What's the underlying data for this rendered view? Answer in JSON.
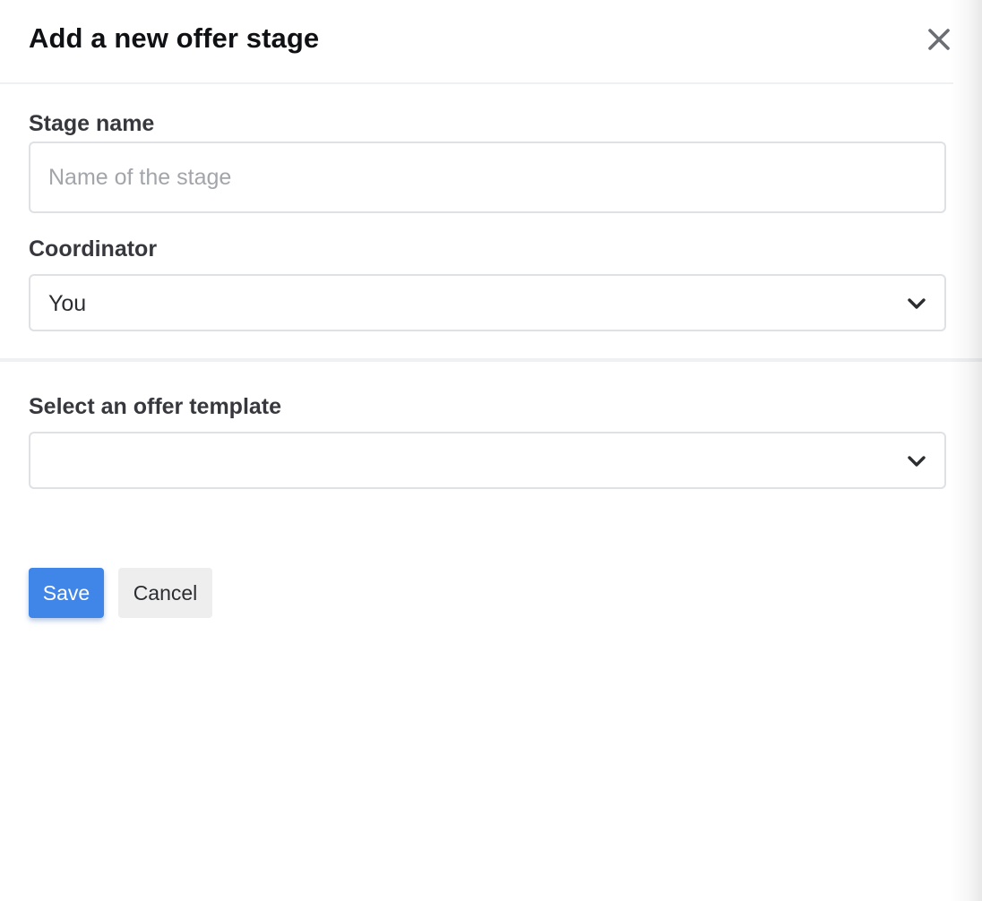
{
  "dialog": {
    "title": "Add a new offer stage",
    "close_icon": "close-icon"
  },
  "form": {
    "stage_name": {
      "label": "Stage name",
      "value": "",
      "placeholder": "Name of the stage"
    },
    "coordinator": {
      "label": "Coordinator",
      "selected": "You",
      "icon": "chevron-down-icon"
    },
    "offer_template": {
      "label": "Select an offer template",
      "selected": "",
      "icon": "chevron-down-icon"
    }
  },
  "actions": {
    "save_label": "Save",
    "cancel_label": "Cancel"
  },
  "colors": {
    "primary": "#3f86e8",
    "secondary_button": "#eeeeef",
    "border": "#dfe1e4",
    "divider": "#eef0f2",
    "title_text": "#101114",
    "placeholder_text": "#a2a5aa"
  }
}
